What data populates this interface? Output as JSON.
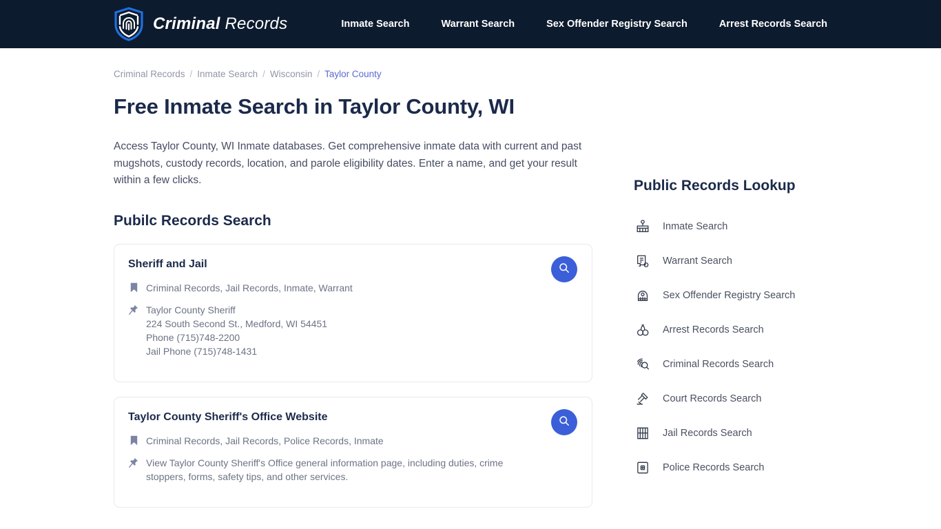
{
  "header": {
    "brand_strong": "Criminal",
    "brand_light": "Records",
    "logo_icon": "shield-fingerprint-icon",
    "background_color": "#0d1b2e",
    "nav": [
      {
        "label": "Inmate Search"
      },
      {
        "label": "Warrant Search"
      },
      {
        "label": "Sex Offender Registry Search"
      },
      {
        "label": "Arrest Records Search"
      }
    ]
  },
  "breadcrumb": {
    "items": [
      {
        "label": "Criminal Records",
        "current": false
      },
      {
        "label": "Inmate Search",
        "current": false
      },
      {
        "label": "Wisconsin",
        "current": false
      },
      {
        "label": "Taylor County",
        "current": true
      }
    ],
    "separator": "/",
    "current_color": "#5b6ad0"
  },
  "main": {
    "title": "Free Inmate Search in Taylor County, WI",
    "intro": "Access Taylor County, WI Inmate databases. Get comprehensive inmate data with current and past mugshots, custody records, location, and parole eligibility dates. Enter a name, and get your result within a few clicks.",
    "section_title": "Pubilc Records Search",
    "accent_color": "#3b5fd9",
    "cards": [
      {
        "title": "Sheriff and Jail",
        "tags_icon": "bookmark-icon",
        "tags": "Criminal Records, Jail Records, Inmate, Warrant",
        "details_icon": "pin-icon",
        "details": [
          "Taylor County Sheriff",
          "224 South Second St., Medford, WI 54451",
          "Phone (715)748-2200",
          "Jail Phone (715)748-1431"
        ],
        "search_icon": "search-icon"
      },
      {
        "title": "Taylor County Sheriff's Office Website",
        "tags_icon": "bookmark-icon",
        "tags": "Criminal Records, Jail Records, Police Records, Inmate",
        "details_icon": "pin-icon",
        "details": [
          "View Taylor County Sheriff's Office general information page, including duties, crime stoppers, forms, safety tips, and other services."
        ],
        "search_icon": "search-icon"
      }
    ]
  },
  "sidebar": {
    "title": "Public Records Lookup",
    "items": [
      {
        "label": "Inmate Search",
        "icon": "inmate-icon"
      },
      {
        "label": "Warrant Search",
        "icon": "warrant-document-icon"
      },
      {
        "label": "Sex Offender Registry Search",
        "icon": "sex-offender-icon"
      },
      {
        "label": "Arrest Records Search",
        "icon": "handcuffs-icon"
      },
      {
        "label": "Criminal Records Search",
        "icon": "fingerprint-search-icon"
      },
      {
        "label": "Court Records Search",
        "icon": "gavel-icon"
      },
      {
        "label": "Jail Records Search",
        "icon": "jail-bars-icon"
      },
      {
        "label": "Police Records Search",
        "icon": "police-badge-icon"
      }
    ]
  }
}
